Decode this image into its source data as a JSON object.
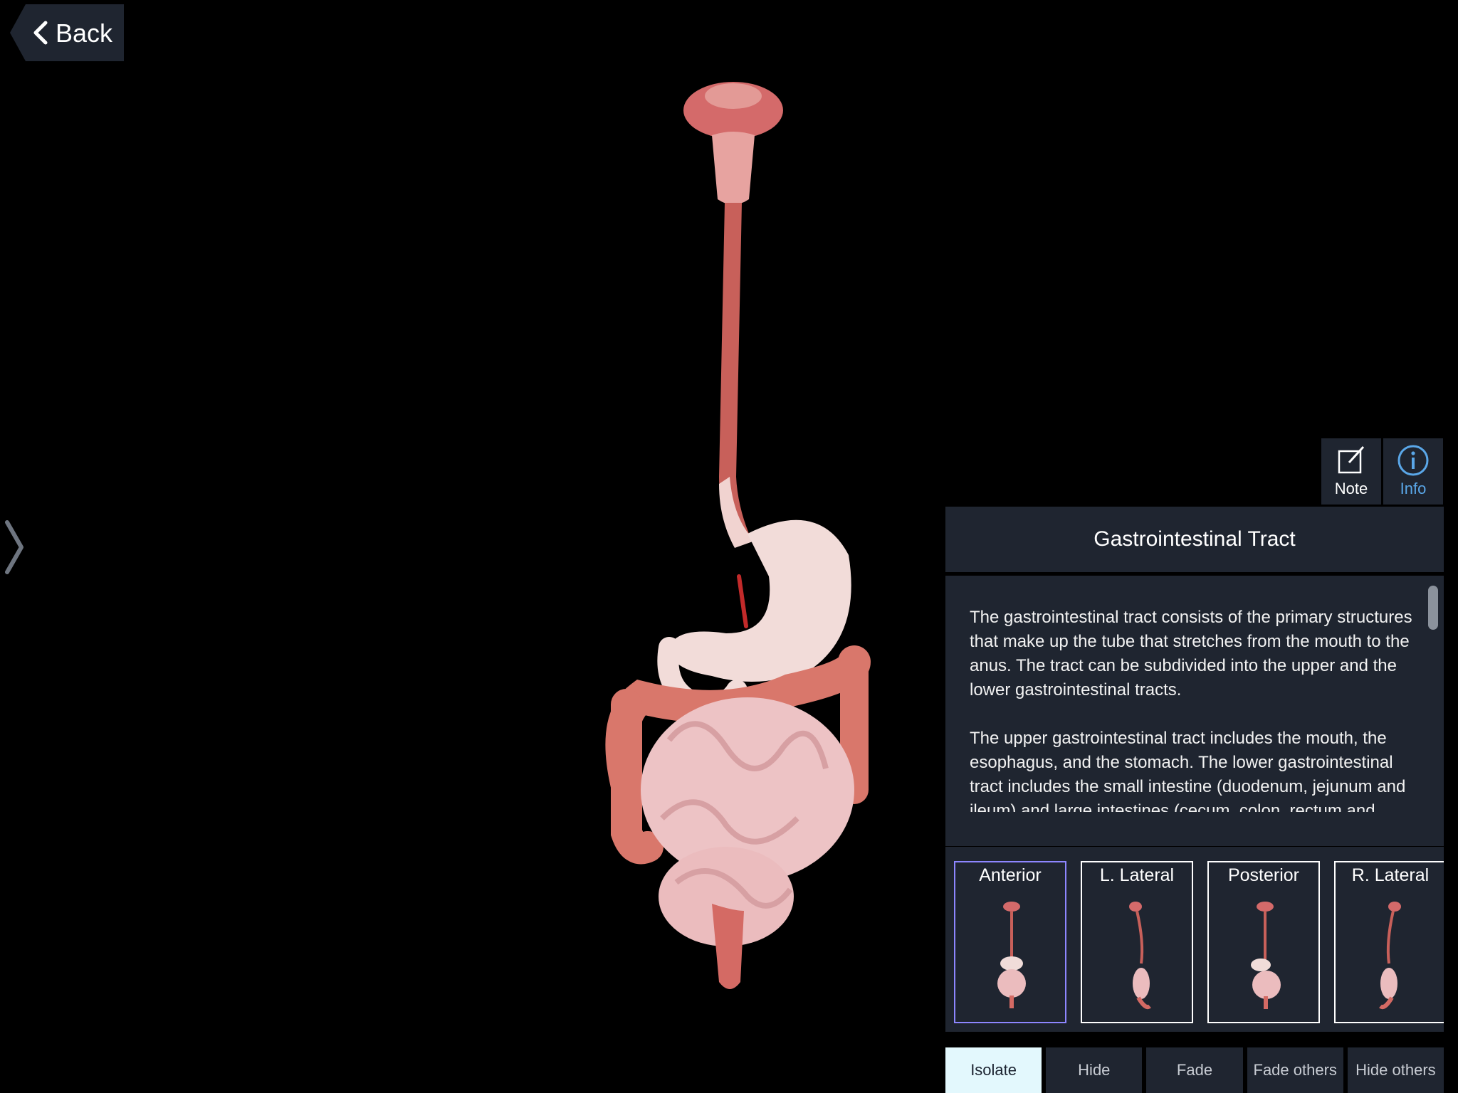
{
  "nav": {
    "back_label": "Back"
  },
  "tools": {
    "note_label": "Note",
    "info_label": "Info"
  },
  "info_panel": {
    "title": "Gastrointestinal Tract",
    "paragraphs": [
      "The gastrointestinal tract consists of the primary structures that make up the tube that stretches from the mouth to the anus. The tract can be subdivided into the upper and the lower gastrointestinal tracts.",
      "The upper gastrointestinal tract includes the mouth, the esophagus, and the stomach. The lower gastrointestinal tract includes the small intestine (duodenum, jejunum and ileum) and large intestines (cecum, colon, rectum and anus)."
    ]
  },
  "views": [
    {
      "label": "Anterior",
      "selected": true
    },
    {
      "label": "L. Lateral",
      "selected": false
    },
    {
      "label": "Posterior",
      "selected": false
    },
    {
      "label": "R. Lateral",
      "selected": false
    }
  ],
  "actions": [
    {
      "label": "Isolate",
      "active": true
    },
    {
      "label": "Hide",
      "active": false
    },
    {
      "label": "Fade",
      "active": false
    },
    {
      "label": "Fade others",
      "active": false
    },
    {
      "label": "Hide others",
      "active": false
    }
  ],
  "colors": {
    "panel_bg": "#1f2530",
    "accent_info": "#5aa7e8",
    "selected_border": "#8d86ff",
    "active_action_bg": "#e3f8fd"
  }
}
